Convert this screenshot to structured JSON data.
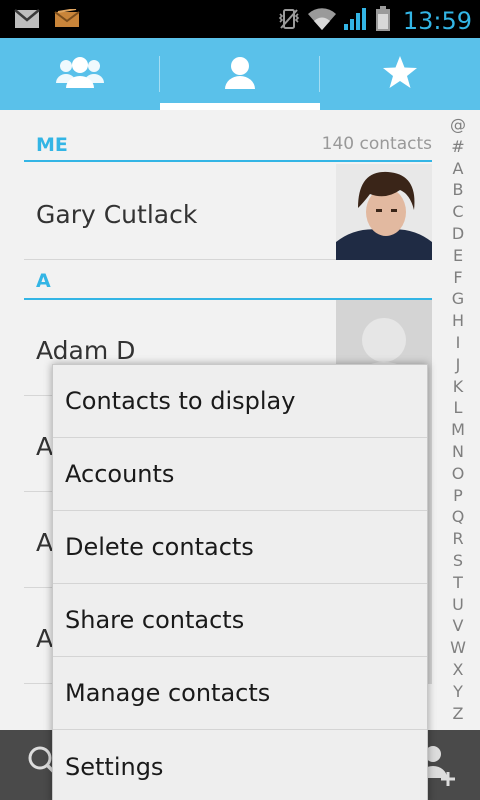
{
  "status_bar": {
    "time": "13:59",
    "left_icons": [
      "gmail-icon",
      "email-icon"
    ],
    "right_icons": [
      "vibrate-icon",
      "wifi-icon",
      "signal-icon",
      "battery-icon"
    ]
  },
  "tabs": [
    {
      "icon": "groups-icon",
      "active": false
    },
    {
      "icon": "person-icon",
      "active": true
    },
    {
      "icon": "star-icon",
      "active": false
    }
  ],
  "list": {
    "me_section": "ME",
    "contact_count": "140 contacts",
    "me_name": "Gary Cutlack",
    "a_section": "A",
    "rows": [
      {
        "name": "Adam D"
      },
      {
        "name": "A"
      },
      {
        "name": "A"
      },
      {
        "name": "A"
      }
    ]
  },
  "index_letters": [
    "@",
    "#",
    "A",
    "B",
    "C",
    "D",
    "E",
    "F",
    "G",
    "H",
    "I",
    "J",
    "K",
    "L",
    "M",
    "N",
    "O",
    "P",
    "Q",
    "R",
    "S",
    "T",
    "U",
    "V",
    "W",
    "X",
    "Y",
    "Z"
  ],
  "menu": {
    "items": [
      {
        "label": "Contacts to display"
      },
      {
        "label": "Accounts"
      },
      {
        "label": "Delete contacts"
      },
      {
        "label": "Share contacts"
      },
      {
        "label": "Manage contacts"
      },
      {
        "label": "Settings"
      }
    ]
  },
  "bottom_bar": {
    "icons": [
      "search-icon",
      "add-contact-icon"
    ]
  },
  "colors": {
    "accent": "#33b5e5",
    "tab_bar": "#5ac1ea"
  }
}
